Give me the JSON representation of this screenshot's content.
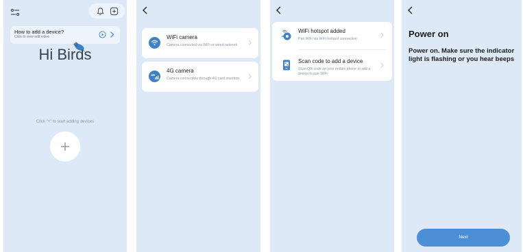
{
  "colors": {
    "screen_bg": "#dde9f6",
    "card_bg": "#ffffff",
    "accent": "#4d8fd6",
    "text_primary": "#1c1c1e",
    "text_secondary": "#8a96a3"
  },
  "home": {
    "icons": [
      "filter-icon",
      "bell-icon",
      "add-square-icon",
      "play-circle-icon",
      "bird-icon",
      "plus-icon"
    ],
    "howto_title": "How to add a device?",
    "howto_subtitle": "Click to view add video",
    "brand": "Hi Birds",
    "hint": "Click \"+\" to start adding devices"
  },
  "device_type": {
    "options": [
      {
        "title": "WiFi camera",
        "description": "Camera connected via WiFi or wired network",
        "icon": "wifi-icon"
      },
      {
        "title": "4G camera",
        "description": "Camera connectible through 4G card insertion",
        "icon": "signal-4g-icon"
      }
    ]
  },
  "add_method": {
    "options": [
      {
        "title": "WiFi hotspot added",
        "description": "Pair WiFi via WiFi hotspot connection",
        "icon": "hotspot-icon"
      },
      {
        "title": "Scan code to add a device",
        "description": "Scan QR code on your mobile phone to add a device to pair WiFi",
        "icon": "qr-phone-icon"
      }
    ]
  },
  "power_on": {
    "title": "Power on",
    "description": "Power on. Make sure the indicator light is flashing or you hear beeps",
    "next_label": "Next"
  }
}
